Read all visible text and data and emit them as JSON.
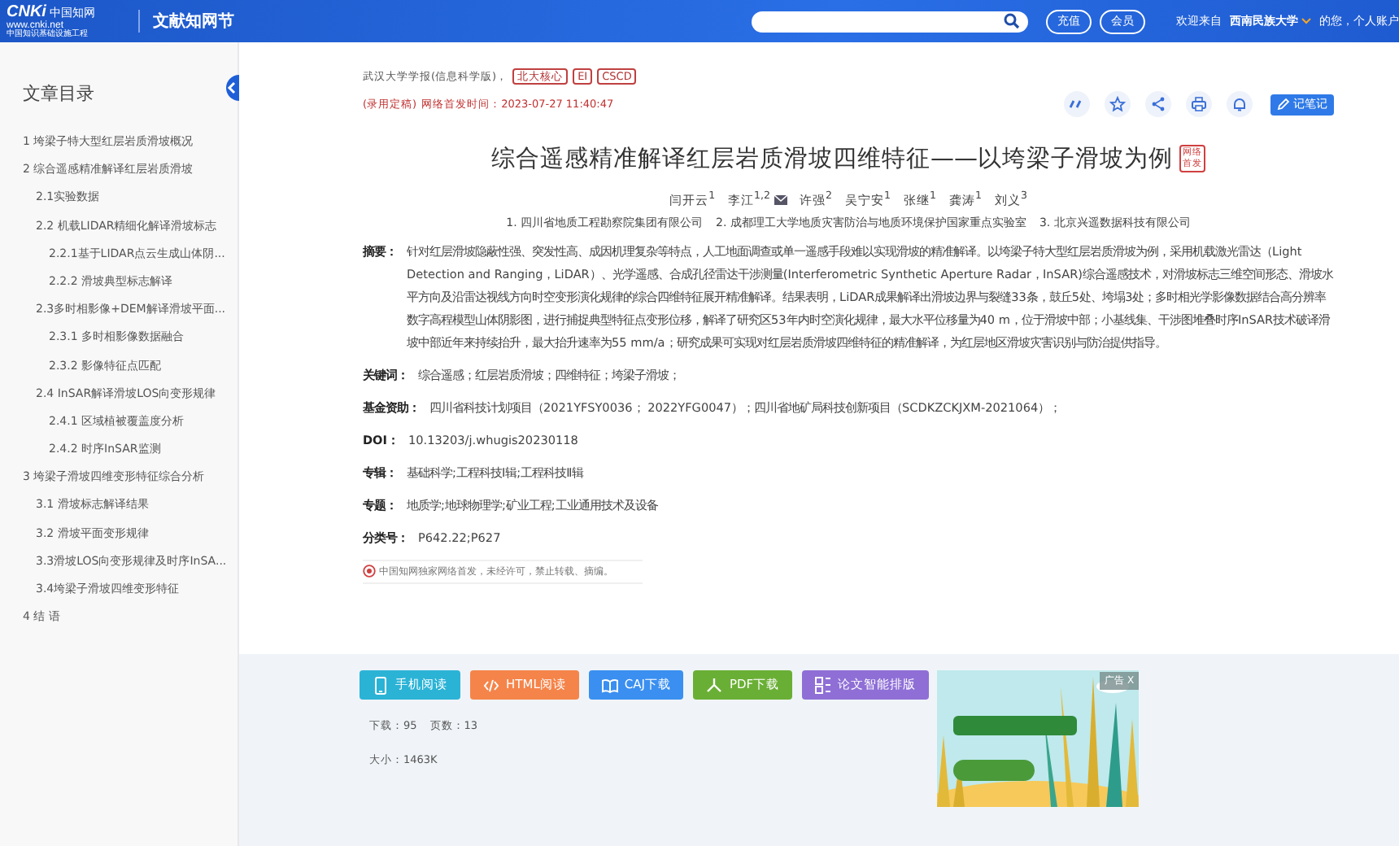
{
  "header": {
    "logo": {
      "mark": "CNKi",
      "cn": "中国知网",
      "url": "www.cnki.net",
      "slogan": "中国知识基础设施工程"
    },
    "section": "文献知网节",
    "buttons": [
      "充值",
      "会员"
    ],
    "welcome": "欢迎来自",
    "institution": "西南民族大学",
    "account": "的您，个人账户"
  },
  "toc": {
    "title": "文章目录",
    "items": [
      {
        "label": "1 垮梁子特大型红层岩质滑坡概况"
      },
      {
        "label": "2 综合遥感精准解译红层岩质滑坡",
        "children": [
          {
            "label": "2.1实验数据"
          },
          {
            "label": "2.2 机载LIDAR精细化解译滑坡标志",
            "children": [
              {
                "label": "2.2.1基于LIDAR点云生成山体阴..."
              },
              {
                "label": "2.2.2 滑坡典型标志解译"
              }
            ]
          },
          {
            "label": "2.3多时相影像+DEM解译滑坡平面...",
            "children": [
              {
                "label": "2.3.1 多时相影像数据融合"
              },
              {
                "label": "2.3.2 影像特征点匹配"
              }
            ]
          },
          {
            "label": "2.4 InSAR解译滑坡LOS向变形规律",
            "children": [
              {
                "label": "2.4.1 区域植被覆盖度分析"
              },
              {
                "label": "2.4.2 时序InSAR监测"
              }
            ]
          }
        ]
      },
      {
        "label": "3 垮梁子滑坡四维变形特征综合分析",
        "children": [
          {
            "label": "3.1 滑坡标志解译结果"
          },
          {
            "label": "3.2 滑坡平面变形规律"
          },
          {
            "label": "3.3滑坡LOS向变形规律及时序InSA..."
          },
          {
            "label": "3.4垮梁子滑坡四维变形特征"
          }
        ]
      },
      {
        "label": "4 结 语"
      }
    ]
  },
  "article": {
    "journal": "武汉大学学报(信息科学版)，",
    "tags": [
      "北大核心",
      "EI",
      "CSCD"
    ],
    "status": "(录用定稿)",
    "pub_time": "网络首发时间：2023-07-27 11:40:47",
    "actions": [
      {
        "kind": "quote"
      },
      {
        "kind": "star"
      },
      {
        "kind": "share"
      },
      {
        "kind": "print"
      },
      {
        "kind": "bell"
      }
    ],
    "note_button": "记笔记",
    "title": "综合遥感精准解译红层岩质滑坡四维特征——以垮梁子滑坡为例",
    "title_badge": "网络首发",
    "authors": [
      {
        "name": "闫开云$^{1}$",
        "mail": false
      },
      {
        "name": "李江$^{1,2}$",
        "mail": true
      },
      {
        "name": "许强$^{2}$",
        "mail": false
      },
      {
        "name": "吴宁安$^{1}$",
        "mail": false
      },
      {
        "name": "张继$^{1}$",
        "mail": false
      },
      {
        "name": "龚涛$^{1}$",
        "mail": false
      },
      {
        "name": "刘义$^{3}$",
        "mail": false
      }
    ],
    "affiliations": [
      "1. 四川省地质工程勘察院集团有限公司",
      "2. 成都理工大学地质灾害防治与地质环境保护国家重点实验室",
      "3. 北京兴遥数据科技有限公司"
    ],
    "fields": [
      {
        "label": "摘要：",
        "value": "针对红层滑坡隐蔽性强、突发性高、成因机理复杂等特点，人工地面调查或单一遥感手段难以实现滑坡的精准解译。以垮梁子特大型红层岩质滑坡为例，采用机载激光雷达（Light Detection and Ranging，LiDAR）、光学遥感、合成孔径雷达干涉测量(Interferometric Synthetic Aperture Radar，InSAR)综合遥感技术，对滑坡标志三维空间形态、滑坡水平方向及沿雷达视线方向时空变形演化规律的综合四维特征展开精准解译。结果表明，LiDAR成果解译出滑坡边界与裂缝33条，鼓丘5处、垮塌3处；多时相光学影像数据结合高分辨率数字高程模型山体阴影图，进行捕捉典型特征点变形位移，解译了研究区53年内时空演化规律，最大水平位移量为40 m，位于滑坡中部；小基线集、干涉图堆叠时序InSAR技术破译滑坡中部近年来持续抬升，最大抬升速率为55 mm/a；研究成果可实现对红层岩质滑坡四维特征的精准解译，为红层地区滑坡灾害识别与防治提供指导。"
      },
      {
        "label": "关键词：",
        "value": "综合遥感；红层岩质滑坡；四维特征；垮梁子滑坡；"
      },
      {
        "label": "基金资助：",
        "value": "四川省科技计划项目（2021YFSY0036； 2022YFG0047）；四川省地矿局科技创新项目（SCDKZCKJXM-2021064）；"
      },
      {
        "label": "DOI：",
        "value": "10.13203/j.whugis20230118"
      },
      {
        "label": "专辑：",
        "value": "基础科学;工程科技Ⅰ辑;工程科技Ⅱ辑"
      },
      {
        "label": "专题：",
        "value": "地质学;地球物理学;矿业工程;工业通用技术及设备"
      },
      {
        "label": "分类号：",
        "value": "P642.22;P627"
      }
    ],
    "notice": "中国知网独家网络首发，未经许可，禁止转载、摘编。"
  },
  "downloads": {
    "buttons": [
      {
        "label": "手机阅读",
        "kind": "phone",
        "color": "#2bb3d6"
      },
      {
        "label": "HTML阅读",
        "kind": "code",
        "color": "#f5844a"
      },
      {
        "label": "CAJ下载",
        "kind": "book",
        "color": "#3a8ff0"
      },
      {
        "label": "PDF下载",
        "kind": "pdf",
        "color": "#6aaf35"
      },
      {
        "label": "论文智能排版",
        "kind": "layout",
        "color": "#8f6fd6"
      }
    ],
    "stats": [
      "下载：95",
      "页数：13"
    ],
    "size": "大小：1463K"
  },
  "ad": {
    "label": "广告 X"
  }
}
